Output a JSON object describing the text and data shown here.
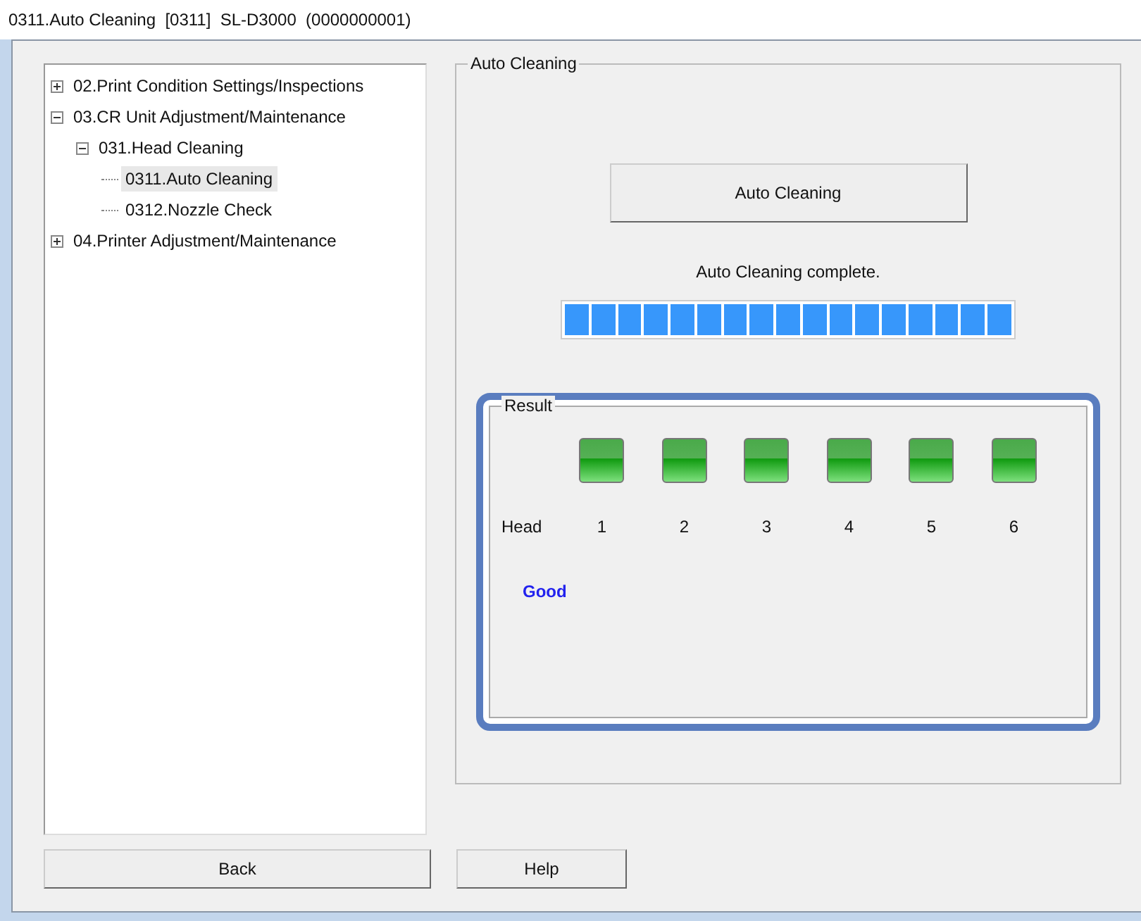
{
  "window": {
    "title": "0311.Auto Cleaning  [0311]  SL-D3000  (0000000001)"
  },
  "tree": [
    {
      "label": "02.Print Condition Settings/Inspections",
      "expanded": false,
      "selected": false
    },
    {
      "label": "03.CR Unit Adjustment/Maintenance",
      "expanded": true,
      "selected": false,
      "children": [
        {
          "label": "031.Head Cleaning",
          "expanded": true,
          "selected": false,
          "children": [
            {
              "label": "0311.Auto Cleaning",
              "selected": true
            },
            {
              "label": "0312.Nozzle Check",
              "selected": false
            }
          ]
        }
      ]
    },
    {
      "label": "04.Printer Adjustment/Maintenance",
      "expanded": false,
      "selected": false
    }
  ],
  "group": {
    "title": "Auto Cleaning",
    "button": "Auto Cleaning",
    "status": "Auto Cleaning complete.",
    "progress": {
      "level": 1
    }
  },
  "result": {
    "title": "Result",
    "highlighted": true,
    "head_label": "Head",
    "heads": [
      {
        "number": "1",
        "lit": true
      },
      {
        "number": "2",
        "lit": true
      },
      {
        "number": "3",
        "lit": true
      },
      {
        "number": "4",
        "lit": true
      },
      {
        "number": "5",
        "lit": true
      },
      {
        "number": "6",
        "lit": true
      }
    ],
    "verdict": "Good"
  },
  "buttons": [
    {
      "label": "Back"
    },
    {
      "label": "Help"
    }
  ]
}
